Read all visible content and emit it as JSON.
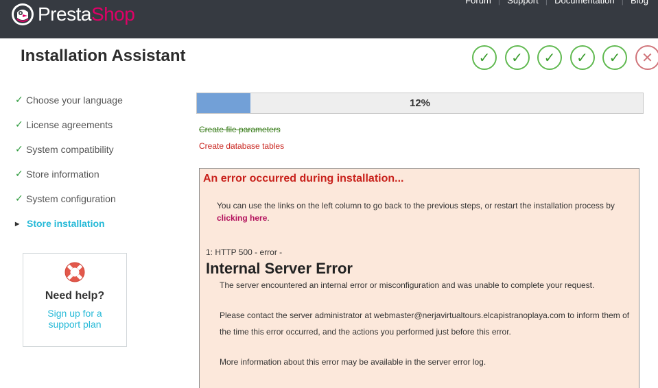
{
  "brand": {
    "name_part1": "Presta",
    "name_part2": "Shop"
  },
  "top_links": [
    "Forum",
    "Support",
    "Documentation",
    "Blog"
  ],
  "header": {
    "title": "Installation Assistant"
  },
  "step_indicators": [
    "✓",
    "✓",
    "✓",
    "✓",
    "✓",
    "✕"
  ],
  "sidebar": {
    "items": [
      {
        "label": "Choose your language",
        "state": "done"
      },
      {
        "label": "License agreements",
        "state": "done"
      },
      {
        "label": "System compatibility",
        "state": "done"
      },
      {
        "label": "Store information",
        "state": "done"
      },
      {
        "label": "System configuration",
        "state": "done"
      },
      {
        "label": "Store installation",
        "state": "current"
      }
    ],
    "check_glyph": "✓",
    "arrow_glyph": "▶"
  },
  "help": {
    "title": "Need help?",
    "link_line1": "Sign up for a",
    "link_line2": "support plan",
    "icon": "lifebuoy-icon"
  },
  "progress": {
    "percent": 12,
    "label": "12%"
  },
  "tasks": {
    "done": "Create file parameters",
    "current": "Create database tables"
  },
  "error": {
    "heading": "An error occurred during installation...",
    "message_before": "You can use the links on the left column to go back to the previous steps, or restart the installation process by ",
    "message_link": "clicking here",
    "message_after": ".",
    "http_line": "1: HTTP 500 - error -",
    "server_title": "Internal Server Error",
    "p1": "The server encountered an internal error or misconfiguration and was unable to complete your request.",
    "p2": "Please contact the server administrator at webmaster@nerjavirtualtours.elcapistranoplaya.com to inform them of the time this error occurred, and the actions you performed just before this error.",
    "p3": "More information about this error may be available in the server error log."
  },
  "colors": {
    "topbar": "#363a41",
    "brand_pink": "#df0067",
    "accent": "#25b9d7",
    "success": "#2c9a3b",
    "error": "#c8211b",
    "progress_fill": "#72a0d7"
  }
}
